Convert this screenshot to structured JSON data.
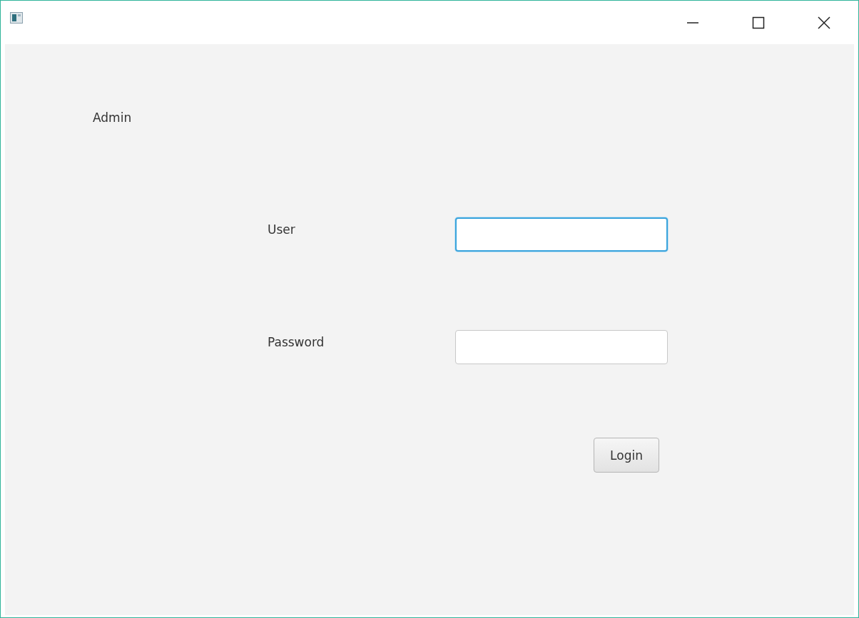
{
  "heading": "Admin",
  "fields": [
    {
      "label": "User",
      "focused": true
    },
    {
      "label": "Password",
      "focused": false
    }
  ],
  "buttons": [
    {
      "label": "Login"
    }
  ]
}
